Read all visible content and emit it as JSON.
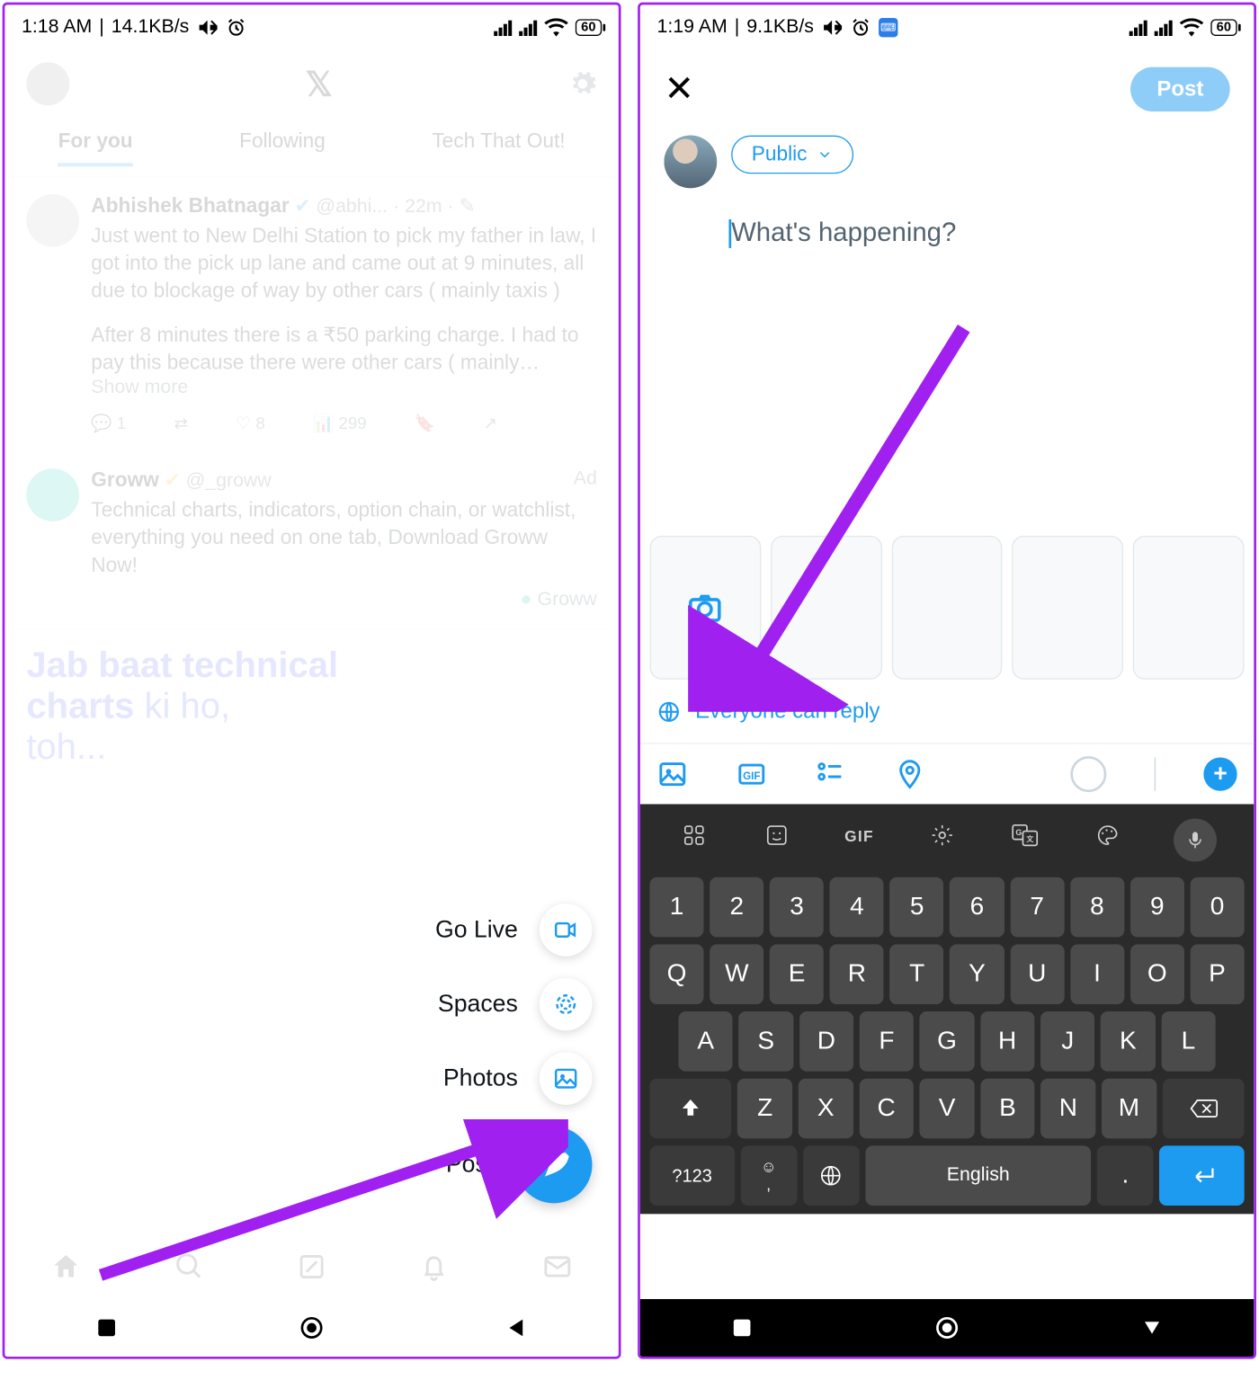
{
  "left": {
    "status": {
      "time": "1:18 AM",
      "net": "14.1KB/s",
      "batt": "60"
    },
    "tabs": [
      "For you",
      "Following",
      "Tech That Out!"
    ],
    "tweet1": {
      "name": "Abhishek Bhatnagar",
      "handle": "@abhi...",
      "time": "· 22m ·",
      "body1": "Just went to New Delhi Station to pick my father in law, I got into the pick up lane and came out at 9 minutes, all due to blockage of way by other cars ( mainly taxis )",
      "body2": "After 8 minutes there is a ₹50 parking charge. I had to pay this because there were other cars ( mainly…",
      "more": "Show more",
      "reply": "1",
      "views": "299"
    },
    "tweet2": {
      "name": "Groww",
      "handle": "@_groww",
      "tag": "Ad",
      "body": "Technical charts, indicators, option chain, or watchlist, everything you need on one tab, Download Groww Now!",
      "brand": "Groww",
      "promo_l1": "Jab baat ",
      "promo_b1": "technical",
      "promo_l2": "charts ",
      "promo_r2": "ki ho,",
      "promo_l3": "toh..."
    },
    "speed": {
      "golive": "Go Live",
      "spaces": "Spaces",
      "photos": "Photos",
      "post": "Post"
    }
  },
  "right": {
    "status": {
      "time": "1:19 AM",
      "net": "9.1KB/s",
      "batt": "60"
    },
    "post_btn": "Post",
    "audience": "Public",
    "placeholder": "What's happening?",
    "reply": "Everyone can reply",
    "keyboard": {
      "gif": "GIF",
      "row1": [
        "1",
        "2",
        "3",
        "4",
        "5",
        "6",
        "7",
        "8",
        "9",
        "0"
      ],
      "row2": [
        "Q",
        "W",
        "E",
        "R",
        "T",
        "Y",
        "U",
        "I",
        "O",
        "P"
      ],
      "row3": [
        "A",
        "S",
        "D",
        "F",
        "G",
        "H",
        "J",
        "K",
        "L"
      ],
      "row4": [
        "Z",
        "X",
        "C",
        "V",
        "B",
        "N",
        "M"
      ],
      "sym": "?123",
      "lang": "English",
      "comma": ",",
      "period": "."
    }
  }
}
